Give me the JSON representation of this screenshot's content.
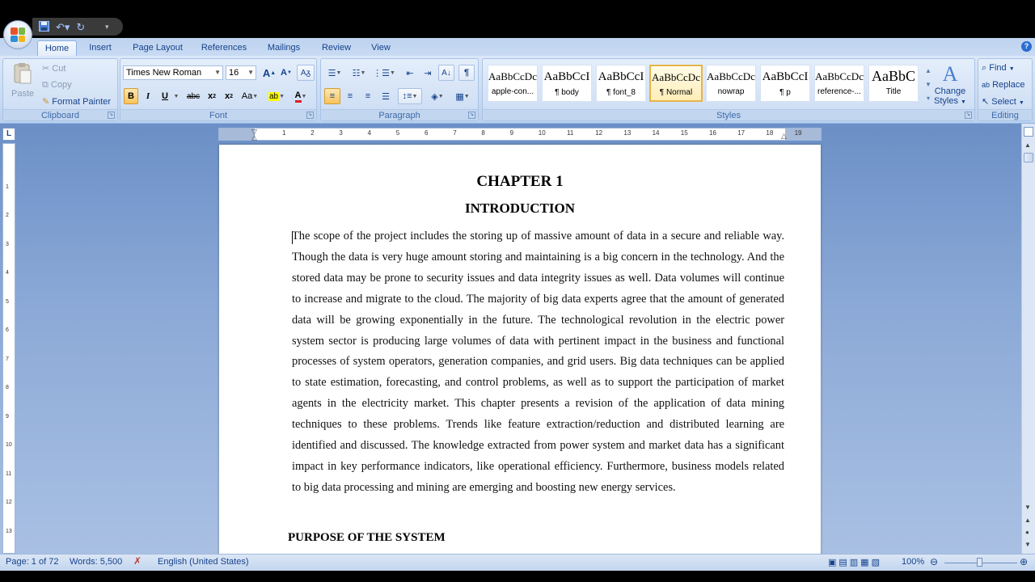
{
  "quick_access": {
    "save_icon": "save-icon",
    "undo_icon": "undo-icon",
    "redo_icon": "redo-icon"
  },
  "tabs": [
    {
      "label": "Home",
      "active": true
    },
    {
      "label": "Insert"
    },
    {
      "label": "Page Layout"
    },
    {
      "label": "References"
    },
    {
      "label": "Mailings"
    },
    {
      "label": "Review"
    },
    {
      "label": "View"
    }
  ],
  "clipboard": {
    "title": "Clipboard",
    "paste": "Paste",
    "cut": "Cut",
    "copy": "Copy",
    "format_painter": "Format Painter"
  },
  "font": {
    "title": "Font",
    "family": "Times New Roman",
    "size": "16",
    "grow": "A",
    "shrink": "A",
    "change_case": "Aa",
    "bold": "B",
    "italic": "I",
    "underline": "U",
    "strikethrough": "abc",
    "subscript": "x",
    "superscript": "x"
  },
  "paragraph": {
    "title": "Paragraph"
  },
  "styles": {
    "title": "Styles",
    "items": [
      {
        "sample": "AaBbCcDc",
        "name": "apple-con..."
      },
      {
        "sample": "AaBbCcI",
        "name": "¶ body"
      },
      {
        "sample": "AaBbCcI",
        "name": "¶ font_8"
      },
      {
        "sample": "AaBbCcDc",
        "name": "¶ Normal",
        "selected": true
      },
      {
        "sample": "AaBbCcDc",
        "name": "nowrap"
      },
      {
        "sample": "AaBbCcI",
        "name": "¶ p"
      },
      {
        "sample": "AaBbCcDc",
        "name": "reference-..."
      },
      {
        "sample": "AaBbC",
        "name": "Title"
      }
    ],
    "change_styles_line1": "Change",
    "change_styles_line2": "Styles"
  },
  "editing": {
    "title": "Editing",
    "find": "Find",
    "replace": "Replace",
    "select": "Select"
  },
  "ruler": {
    "numbers": [
      "1",
      "2",
      "3",
      "4",
      "5",
      "6",
      "7",
      "8",
      "9",
      "10",
      "11",
      "12",
      "13",
      "14",
      "15",
      "16",
      "17",
      "18",
      "19"
    ]
  },
  "document": {
    "chapter": "CHAPTER 1",
    "heading": "INTRODUCTION",
    "paragraph": "The scope of the project includes the storing up of massive amount of data in a secure and reliable way. Though the data is very huge amount storing and maintaining is a big concern in the technology. And the stored data may be prone to security issues and data integrity issues as well. Data volumes will continue to increase and migrate to the cloud. The majority of big data experts agree that the amount of generated data will be growing exponentially in the future. The technological revolution in the electric power system sector is producing large volumes of data with pertinent impact in the business and functional processes of system operators, generation companies, and grid users. Big data techniques can be applied to state estimation, forecasting, and control problems, as well as to support the participation of market agents in the electricity market. This chapter presents a revision of the application of data mining techniques to these problems. Trends like feature extraction/reduction and distributed learning are identified and discussed. The knowledge extracted from power system and market data has a significant impact in key performance indicators, like operational efficiency. Furthermore, business models related to big data processing and mining are emerging and boosting new energy services.",
    "section_heading": "PURPOSE OF THE SYSTEM"
  },
  "status": {
    "page": "Page: 1 of 72",
    "words": "Words: 5,500",
    "language": "English (United States)",
    "zoom": "100%"
  },
  "colors": {
    "ribbon": "#c7d9f1",
    "workspace": "#8aa8d6",
    "accent": "#15428b",
    "selected_style": "#e6b54a"
  }
}
